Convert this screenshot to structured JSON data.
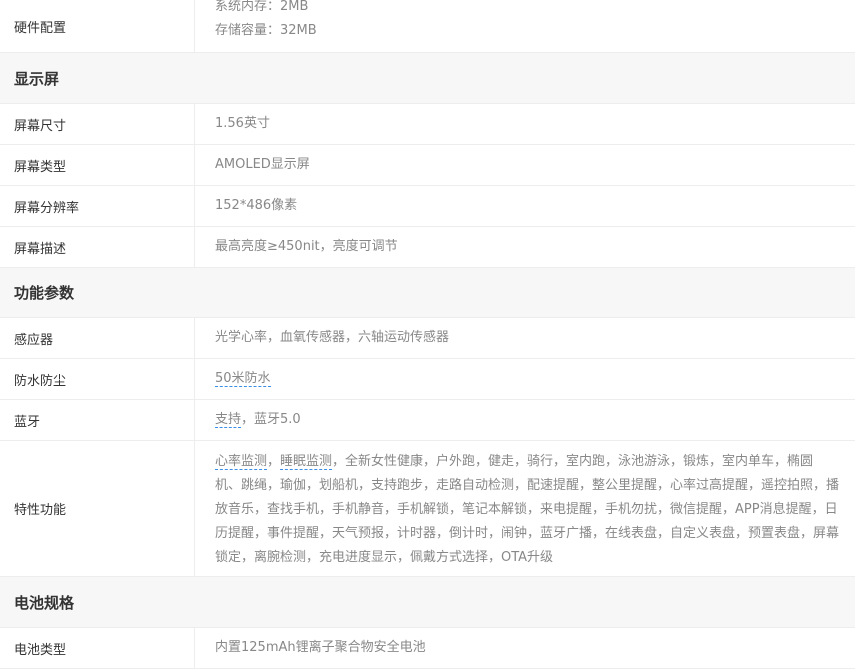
{
  "hardware": {
    "label": "硬件配置",
    "line1": "系统内存：2MB",
    "line2": "存储容量：32MB"
  },
  "display": {
    "title": "显示屏",
    "rows": [
      {
        "label": "屏幕尺寸",
        "value": "1.56英寸"
      },
      {
        "label": "屏幕类型",
        "value": "AMOLED显示屏"
      },
      {
        "label": "屏幕分辨率",
        "value": "152*486像素"
      },
      {
        "label": "屏幕描述",
        "value": "最高亮度≥450nit，亮度可调节"
      }
    ]
  },
  "function": {
    "title": "功能参数",
    "sensor": {
      "label": "感应器",
      "value": "光学心率，血氧传感器，六轴运动传感器"
    },
    "waterproof": {
      "label": "防水防尘",
      "link": "50米防水"
    },
    "bluetooth": {
      "label": "蓝牙",
      "link": "支持",
      "rest": "，蓝牙5.0"
    },
    "features": {
      "label": "特性功能",
      "link1": "心率监测",
      "sep1": "，",
      "link2": "睡眠监测",
      "rest": "，全新女性健康，户外跑，健走，骑行，室内跑，泳池游泳，锻炼，室内单车，椭圆机、跳绳，瑜伽，划船机，支持跑步，走路自动检测，配速提醒，整公里提醒，心率过高提醒，遥控拍照，播放音乐，查找手机，手机静音，手机解锁，笔记本解锁，来电提醒，手机勿扰，微信提醒，APP消息提醒，日历提醒，事件提醒，天气预报，计时器，倒计时，闹钟，蓝牙广播，在线表盘，自定义表盘，预置表盘，屏幕锁定，离腕检测，充电进度显示，佩戴方式选择，OTA升级"
    }
  },
  "battery": {
    "title": "电池规格",
    "type": {
      "label": "电池类型",
      "value": "内置125mAh锂离子聚合物安全电池"
    }
  },
  "colors": {
    "label_text": "#333333",
    "value_text": "#888888",
    "section_bg": "#f7f7f7",
    "border": "#ededed",
    "link_underline": "#3a8ee6"
  }
}
